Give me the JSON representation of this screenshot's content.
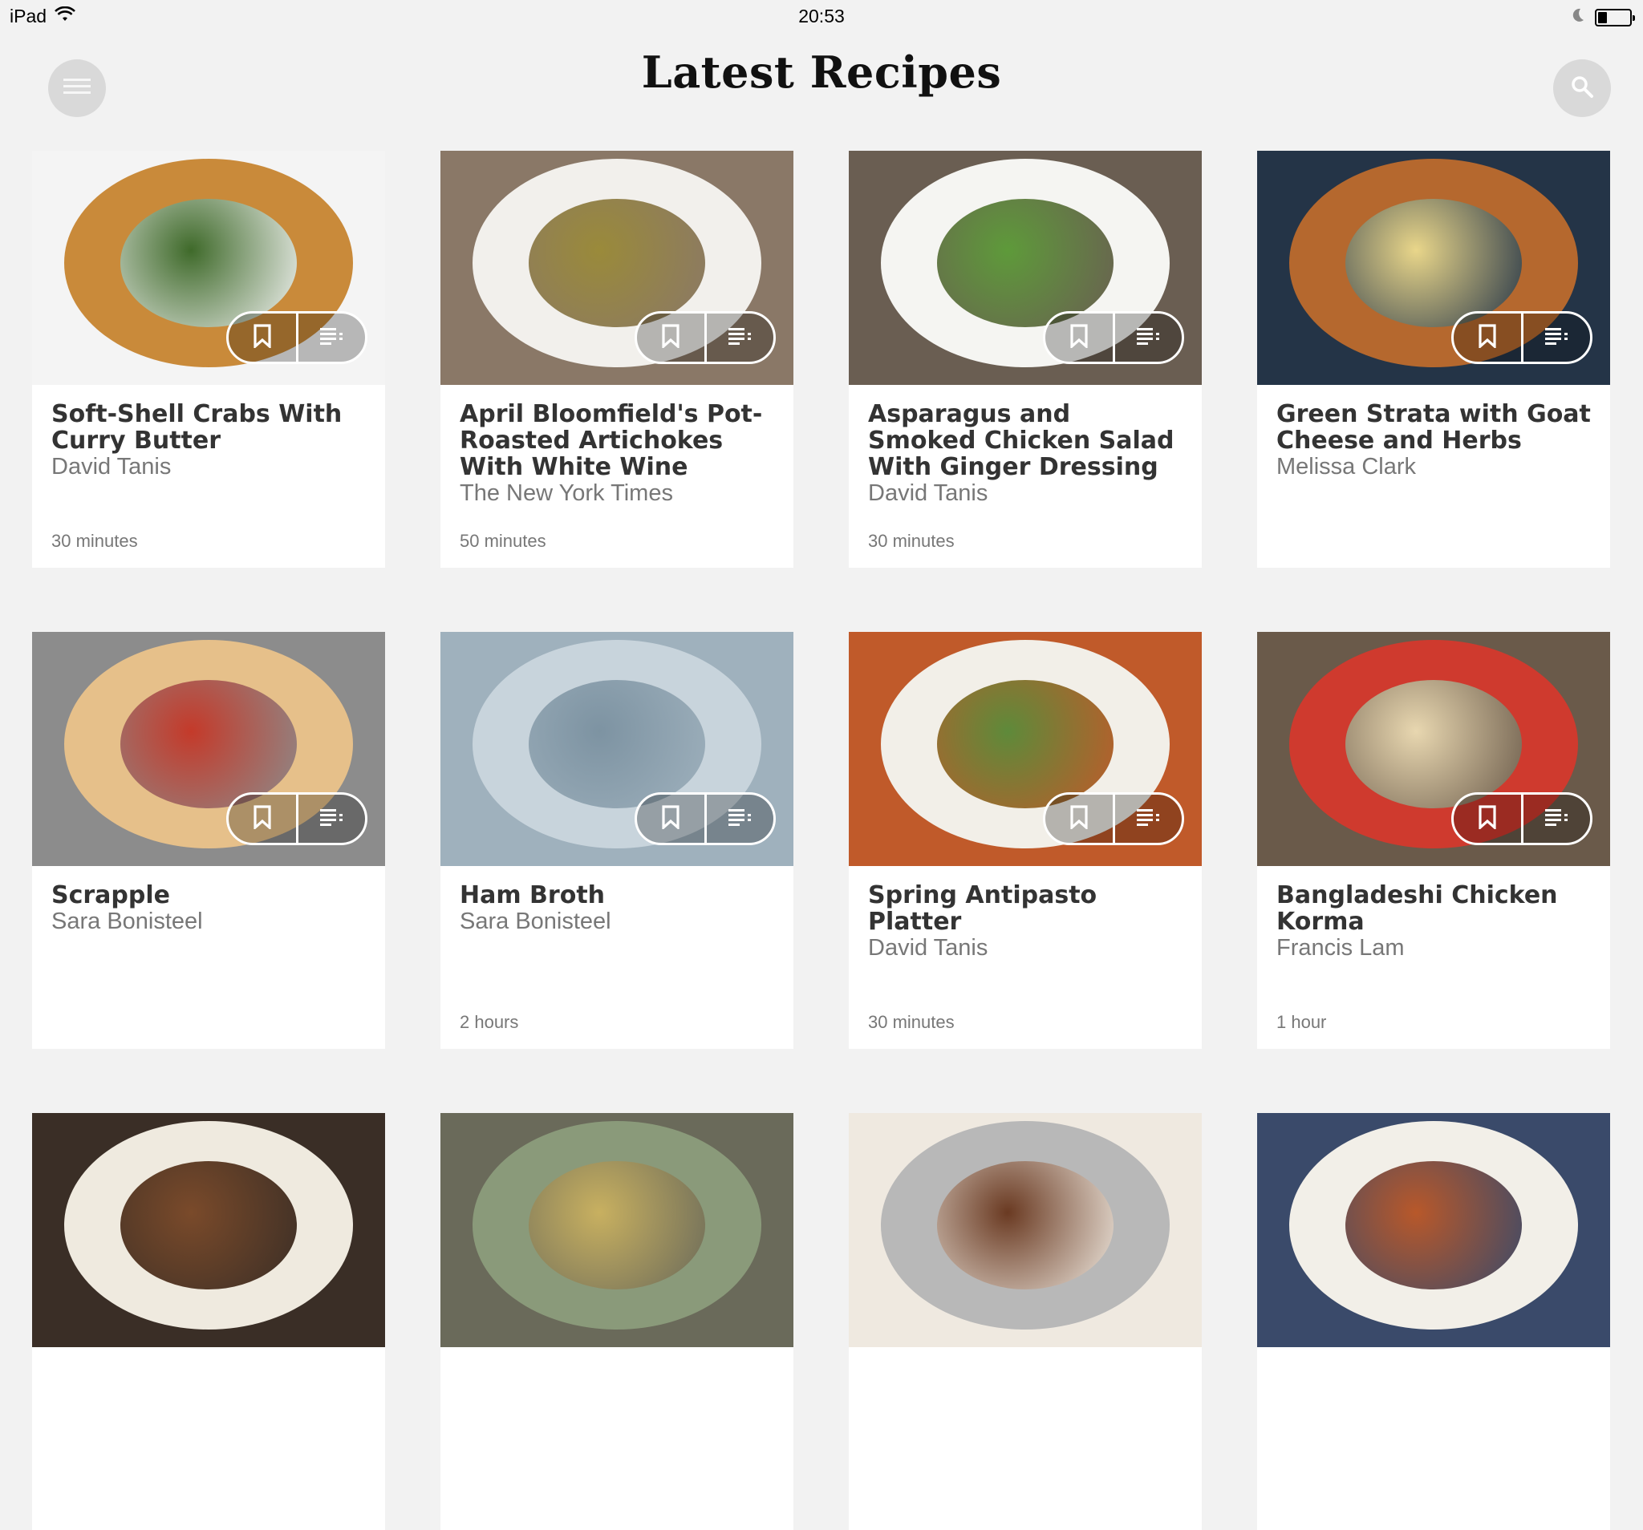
{
  "status_bar": {
    "device": "iPad",
    "time": "20:53",
    "battery_level": 0.3,
    "icons": [
      "wifi-icon",
      "moon-icon",
      "battery-icon"
    ]
  },
  "header": {
    "title": "Latest Recipes",
    "menu_icon": "menu-icon",
    "search_icon": "search-icon"
  },
  "recipes": [
    {
      "title": "Soft-Shell Crabs With Curry Butter",
      "author": "David Tanis",
      "time": "30 minutes",
      "colors": [
        "#f4f4f4",
        "#c98a3a",
        "#3f6a2a"
      ]
    },
    {
      "title": "April Bloomfield's Pot-Roasted Artichokes With White Wine",
      "author": "The New York Times",
      "time": "50 minutes",
      "colors": [
        "#8a7867",
        "#f2f0ec",
        "#9a8a3a"
      ]
    },
    {
      "title": "Asparagus and Smoked Chicken Salad With Ginger Dressing",
      "author": "David Tanis",
      "time": "30 minutes",
      "colors": [
        "#6a5e52",
        "#f5f5f2",
        "#5e9a3a"
      ]
    },
    {
      "title": "Green Strata with Goat Cheese and Herbs",
      "author": "Melissa Clark",
      "time": "",
      "colors": [
        "#243447",
        "#b5682e",
        "#e9d68a"
      ]
    },
    {
      "title": "Scrapple",
      "author": "Sara Bonisteel",
      "time": "",
      "colors": [
        "#8c8c8c",
        "#e6c08a",
        "#c43a2a"
      ]
    },
    {
      "title": "Ham Broth",
      "author": "Sara Bonisteel",
      "time": "2 hours",
      "colors": [
        "#9fb1bd",
        "#c8d4dc",
        "#7d93a2"
      ]
    },
    {
      "title": "Spring Antipasto Platter",
      "author": "David Tanis",
      "time": "30 minutes",
      "colors": [
        "#c05a2a",
        "#f2efe8",
        "#5e8a3a"
      ]
    },
    {
      "title": "Bangladeshi Chicken Korma",
      "author": "Francis Lam",
      "time": "1 hour",
      "colors": [
        "#6a5a4a",
        "#cf3a2e",
        "#e8d7b0"
      ]
    },
    {
      "title": "",
      "author": "",
      "time": "",
      "colors": [
        "#3a2e26",
        "#efeadf",
        "#7a4a2a"
      ]
    },
    {
      "title": "",
      "author": "",
      "time": "",
      "colors": [
        "#6a6a5a",
        "#8a9a7a",
        "#c8b060"
      ]
    },
    {
      "title": "",
      "author": "",
      "time": "",
      "colors": [
        "#efe9e0",
        "#b8b8b8",
        "#6a3a22"
      ]
    },
    {
      "title": "",
      "author": "",
      "time": "",
      "colors": [
        "#3a4a6a",
        "#f2efe8",
        "#b8582a"
      ]
    }
  ],
  "card_actions": {
    "bookmark_icon": "bookmark-icon",
    "list_icon": "recipe-list-icon"
  }
}
